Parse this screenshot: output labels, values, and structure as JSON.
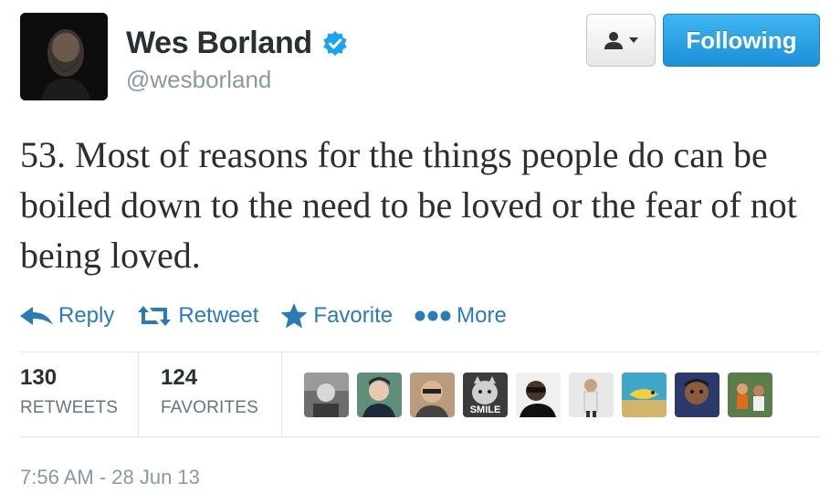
{
  "user": {
    "display_name": "Wes Borland",
    "handle": "@wesborland",
    "verified": true,
    "avatar_icon": "avatar-photo"
  },
  "buttons": {
    "user_menu_icon": "person-icon",
    "follow_label": "Following"
  },
  "tweet": {
    "text": "53. Most of reasons for the things people do can be boiled down to the need to be loved or the fear of not being loved."
  },
  "actions": [
    {
      "label": "Reply",
      "icon": "reply-icon"
    },
    {
      "label": "Retweet",
      "icon": "retweet-icon"
    },
    {
      "label": "Favorite",
      "icon": "star-icon"
    },
    {
      "label": "More",
      "icon": "more-dots-icon"
    }
  ],
  "stats": {
    "retweets_count": "130",
    "retweets_label": "RETWEETS",
    "favorites_count": "124",
    "favorites_label": "FAVORITES"
  },
  "favoriters": [
    {
      "icon": "user-avatar"
    },
    {
      "icon": "user-avatar"
    },
    {
      "icon": "user-avatar"
    },
    {
      "icon": "user-avatar",
      "text": "SMILE"
    },
    {
      "icon": "user-avatar"
    },
    {
      "icon": "user-avatar"
    },
    {
      "icon": "user-avatar"
    },
    {
      "icon": "user-avatar"
    },
    {
      "icon": "user-avatar"
    }
  ],
  "timestamp": "7:56 AM - 28 Jun 13",
  "colors": {
    "link_blue": "#2b7bb9",
    "follow_blue": "#2a9fe3",
    "verified_blue": "#1da1f2",
    "text": "#292f33",
    "muted": "#8899a6"
  }
}
